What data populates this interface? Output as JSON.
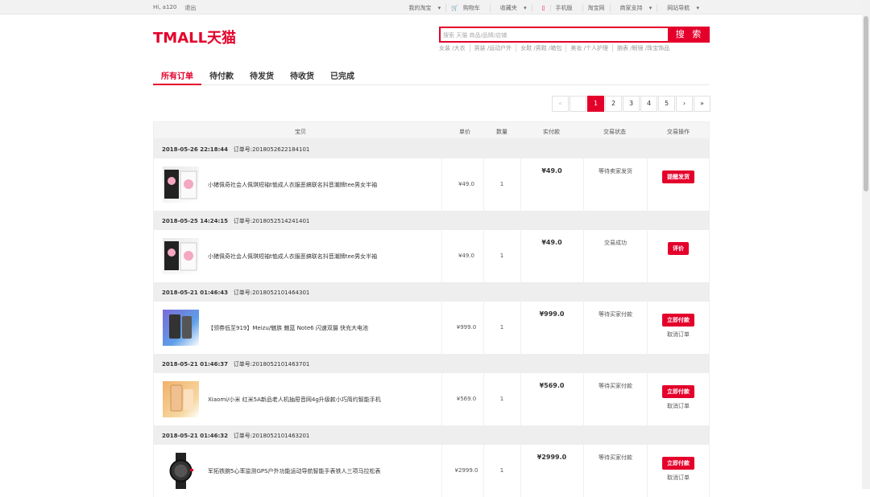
{
  "topbar": {
    "greeting": "Hi,",
    "user": "a120",
    "logout": "退出",
    "links": [
      "我的淘宝",
      "购物车",
      "收藏夹",
      "手机版",
      "淘宝网",
      "商家支持",
      "网站导航"
    ]
  },
  "brand": {
    "logo": "TMALL天猫"
  },
  "search": {
    "placeholder": "搜索 天猫 商品/品牌/店铺",
    "button": "搜 索",
    "hot": [
      "女装 /大衣",
      "男装 /运动户外",
      "女鞋 /男鞋 /箱包",
      "美妆 /个人护理",
      "腕表 /眼镜 /珠宝饰品"
    ]
  },
  "tabs": [
    "所有订单",
    "待付款",
    "待发货",
    "待收货",
    "已完成"
  ],
  "pager": {
    "prev2": "«",
    "prev": "‹",
    "pages": [
      "1",
      "2",
      "3",
      "4",
      "5"
    ],
    "next": "›",
    "last": "»"
  },
  "table": {
    "headers": [
      "宝贝",
      "单价",
      "数量",
      "实付款",
      "交易状态",
      "交易操作"
    ]
  },
  "orders": [
    {
      "date": "2018-05-26 22:18:44",
      "order_no": "订单号:2018052622184101",
      "title": "小猪佩奇社会人佩琪短袖t恤成人衣服恶搞联名抖音潮牌tee男女半袖",
      "price": "¥49.0",
      "qty": "1",
      "paid": "¥49.0",
      "status": "等待卖家发货",
      "action": "提醒发货",
      "cancel": ""
    },
    {
      "date": "2018-05-25 14:24:15",
      "order_no": "订单号:2018052514241401",
      "title": "小猪佩奇社会人佩琪短袖t恤成人衣服恶搞联名抖音潮牌tee男女半袖",
      "price": "¥49.0",
      "qty": "1",
      "paid": "¥49.0",
      "status": "交易成功",
      "action": "评价",
      "cancel": ""
    },
    {
      "date": "2018-05-21 01:46:43",
      "order_no": "订单号:2018052101464301",
      "title": "【领券低至919】Meizu/魅族 魅蓝 Note6 闪速双摄 快充大电池",
      "price": "¥999.0",
      "qty": "1",
      "paid": "¥999.0",
      "status": "等待买家付款",
      "action": "立即付款",
      "cancel": "取消订单"
    },
    {
      "date": "2018-05-21 01:46:37",
      "order_no": "订单号:2018052101463701",
      "title": "Xiaomi/小米 红米5A新品老人机抽屉音网4g升级款小巧简约智能手机",
      "price": "¥569.0",
      "qty": "1",
      "paid": "¥569.0",
      "status": "等待买家付款",
      "action": "立即付款",
      "cancel": "取消订单"
    },
    {
      "date": "2018-05-21 01:46:32",
      "order_no": "订单号:2018052101463201",
      "title": "军拓铁腕5心率监测GPS户外功能运动导航智能手表铁人三项马拉松表",
      "price": "¥2999.0",
      "qty": "1",
      "paid": "¥2999.0",
      "status": "等待买家付款",
      "action": "立即付款",
      "cancel": "取消订单"
    }
  ]
}
